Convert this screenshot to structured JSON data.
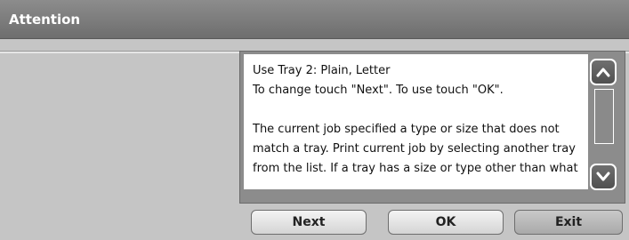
{
  "window": {
    "title": "Attention"
  },
  "message": {
    "lines": [
      "Use Tray 2: Plain, Letter",
      "To change touch \"Next\". To use touch \"OK\".",
      "",
      "The current job specified a type or size that does not",
      "match a tray. Print current job by selecting another tray",
      "from the list. If a tray has a size or type other than what"
    ]
  },
  "buttons": {
    "next": "Next",
    "ok": "OK",
    "exit": "Exit"
  },
  "icons": {
    "scroll_up": "chevron-up-icon",
    "scroll_down": "chevron-down-icon"
  }
}
